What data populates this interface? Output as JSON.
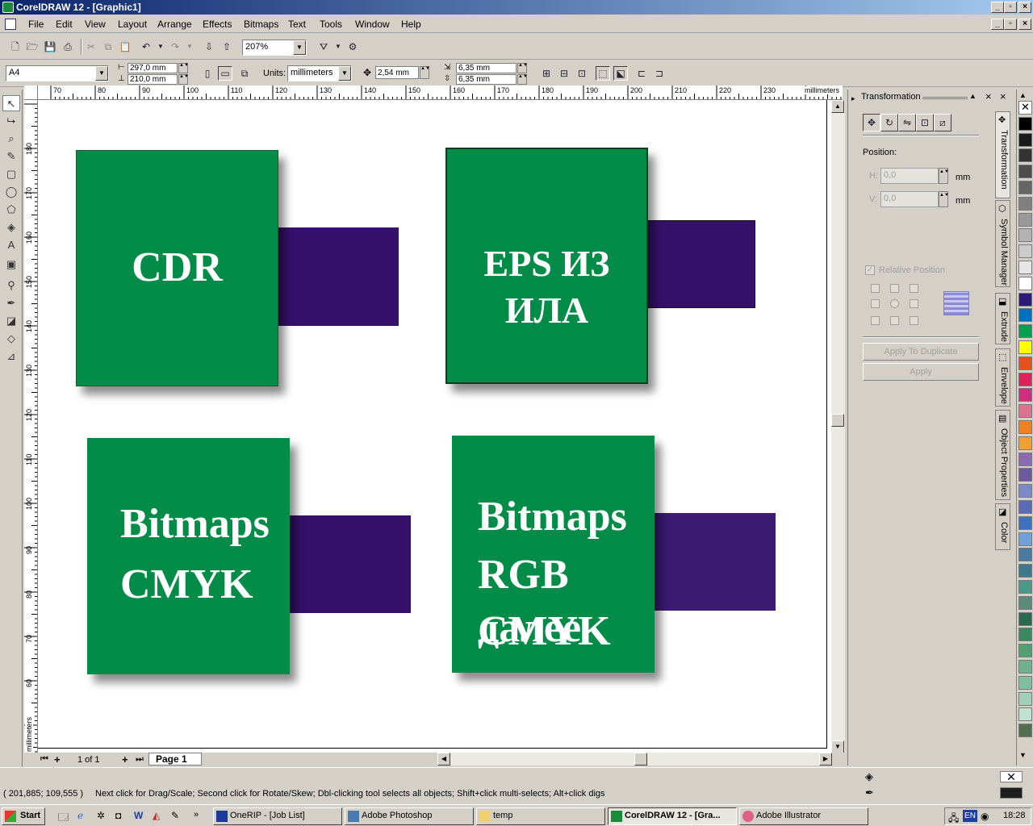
{
  "window": {
    "title": "CorelDRAW 12 - [Graphic1]"
  },
  "menu": {
    "items": [
      "File",
      "Edit",
      "View",
      "Layout",
      "Arrange",
      "Effects",
      "Bitmaps",
      "Text",
      "Tools",
      "Window",
      "Help"
    ]
  },
  "standard_toolbar": {
    "zoom": "207%"
  },
  "property_bar": {
    "paper": "A4",
    "width": "297,0 mm",
    "height": "210,0 mm",
    "units_label": "Units:",
    "units": "millimeters",
    "nudge": "2,54 mm",
    "dup_x": "6,35 mm",
    "dup_y": "6,35 mm"
  },
  "rulers": {
    "unit_h": "millimeters",
    "unit_v": "millimeters",
    "h_ticks": [
      "70",
      "80",
      "90",
      "100",
      "110",
      "120",
      "130",
      "140",
      "150",
      "160",
      "170",
      "180",
      "190",
      "200",
      "210",
      "220",
      "230"
    ],
    "v_ticks": [
      "180",
      "170",
      "160",
      "150",
      "140",
      "130",
      "120",
      "110",
      "100",
      "90",
      "80",
      "70",
      "60"
    ]
  },
  "canvas": {
    "colors": {
      "green": "#028c48",
      "purple": "#36116c"
    },
    "objects": [
      {
        "lines": [
          "CDR"
        ]
      },
      {
        "lines": [
          "EPS ИЗ ИЛА"
        ]
      },
      {
        "lines": [
          "Bitmaps",
          "CMYK"
        ]
      },
      {
        "lines": [
          "Bitmaps",
          "RGB далее",
          "CMYK"
        ]
      }
    ]
  },
  "page_nav": {
    "count": "1 of 1",
    "tab": "Page 1"
  },
  "docker": {
    "title": "Transformation",
    "position_label": "Position:",
    "h_label": "H:",
    "h_value": "0,0",
    "v_label": "V:",
    "v_value": "0,0",
    "unit": "mm",
    "relative_position": "Relative Position",
    "apply_dup": "Apply To Duplicate",
    "apply": "Apply"
  },
  "docker_tabs": [
    "Transformation",
    "Symbol Manager",
    "Extrude",
    "Envelope",
    "Object Properties",
    "Color"
  ],
  "palette": [
    "#ffffff",
    "#000000",
    "#1a1a1a",
    "#333333",
    "#4d4d4d",
    "#666666",
    "#808080",
    "#999999",
    "#b3b3b3",
    "#cccccc",
    "#e6e6e6",
    "#ffffff",
    "#2e1a78",
    "#0070c0",
    "#00a050",
    "#ffff00",
    "#e8501c",
    "#e0205a",
    "#d02c80",
    "#e07090",
    "#f08020",
    "#f0a030",
    "#8b6ab0",
    "#6c5aa0",
    "#7a8ac8",
    "#5a6ab8",
    "#4070c0",
    "#70a0d8",
    "#4a7aa0",
    "#3a7a8a",
    "#4a9a8a",
    "#5a8a7a",
    "#2a6a50",
    "#3a8a60",
    "#50a070",
    "#70b090",
    "#80c0a0",
    "#a0d0b8",
    "#c0e0d0",
    "#507050"
  ],
  "status": {
    "coords": "( 201,885; 109,555 )",
    "hint": "Next click for Drag/Scale; Second click for Rotate/Skew; Dbl-clicking tool selects all objects; Shift+click multi-selects; Alt+click digs"
  },
  "taskbar": {
    "start": "Start",
    "tasks": [
      "OneRIP - [Job List]",
      "Adobe Photoshop",
      "temp",
      "CorelDRAW 12 - [Gra...",
      "Adobe Illustrator"
    ],
    "lang": "EN",
    "time": "18:28"
  }
}
